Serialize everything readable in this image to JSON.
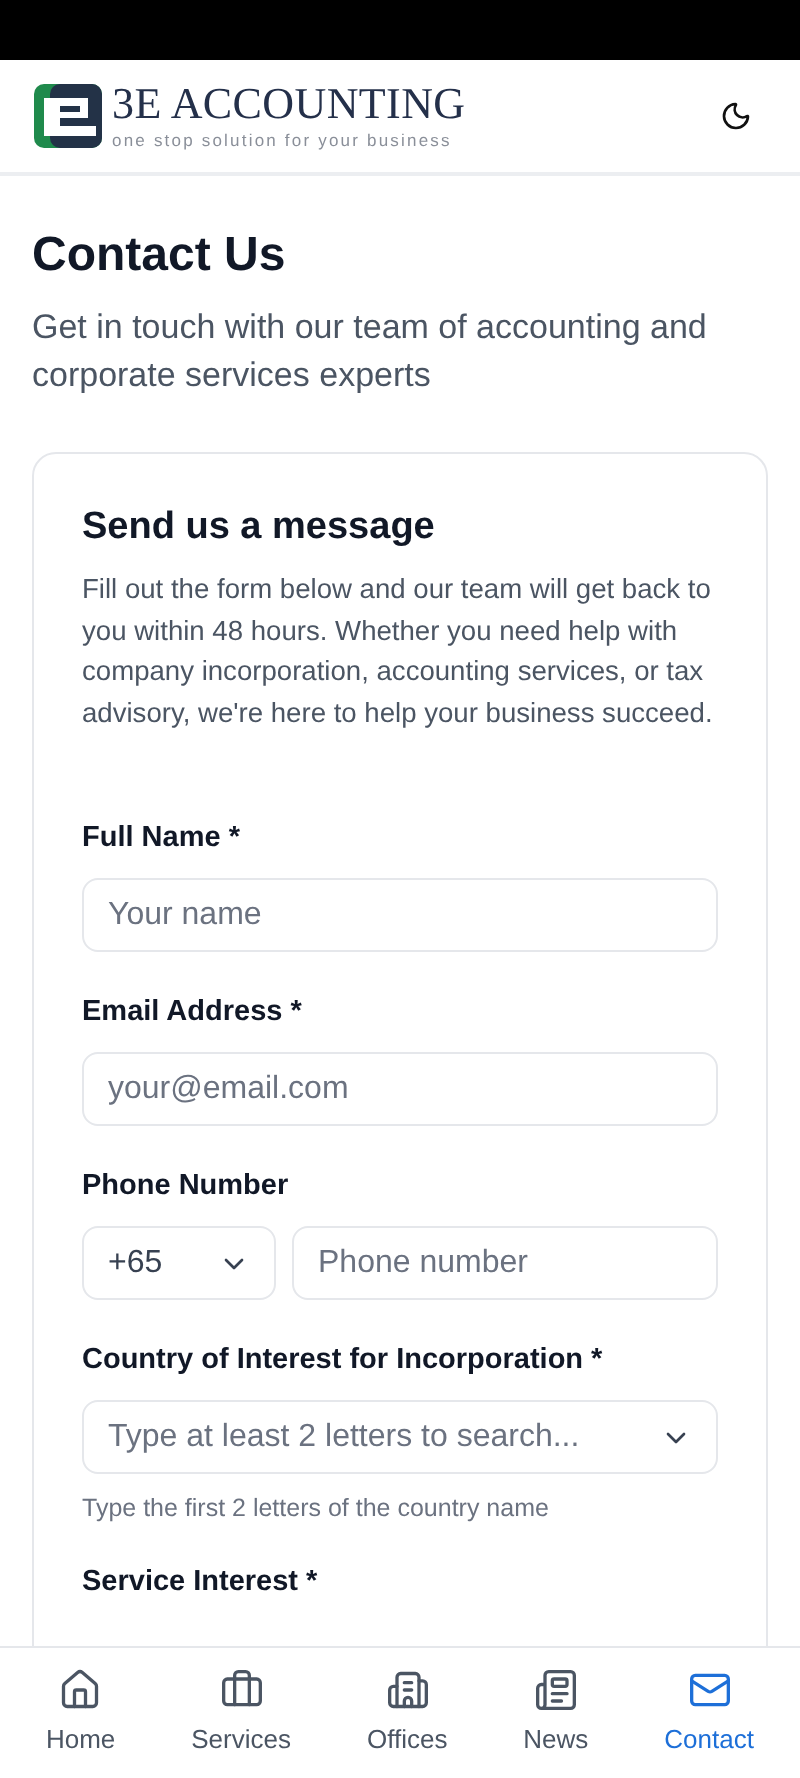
{
  "header": {
    "logo_title": "3E ACCOUNTING",
    "logo_tagline": "one stop solution for your business"
  },
  "page": {
    "title": "Contact Us",
    "subtitle": "Get in touch with our team of accounting and corporate services experts"
  },
  "form": {
    "title": "Send us a message",
    "intro": "Fill out the form below and our team will get back to you within 48 hours. Whether you need help with company incorporation, accounting services, or tax advisory, we're here to help your business succeed.",
    "fields": [
      {
        "kind": "text",
        "label": "Full Name *",
        "placeholder": "Your name"
      },
      {
        "kind": "text",
        "label": "Email Address *",
        "placeholder": "your@email.com"
      },
      {
        "kind": "phone",
        "label": "Phone Number",
        "code": "+65",
        "placeholder": "Phone number"
      },
      {
        "kind": "select",
        "label": "Country of Interest for Incorporation *",
        "placeholder": "Type at least 2 letters to search...",
        "hint": "Type the first 2 letters of the country name"
      },
      {
        "kind": "label",
        "label": "Service Interest *"
      }
    ]
  },
  "nav": [
    {
      "kind": "home",
      "label": "Home",
      "selected": false
    },
    {
      "kind": "services",
      "label": "Services",
      "selected": false
    },
    {
      "kind": "offices",
      "label": "Offices",
      "selected": false
    },
    {
      "kind": "news",
      "label": "News",
      "selected": false
    },
    {
      "kind": "contact",
      "label": "Contact",
      "selected": true
    }
  ]
}
